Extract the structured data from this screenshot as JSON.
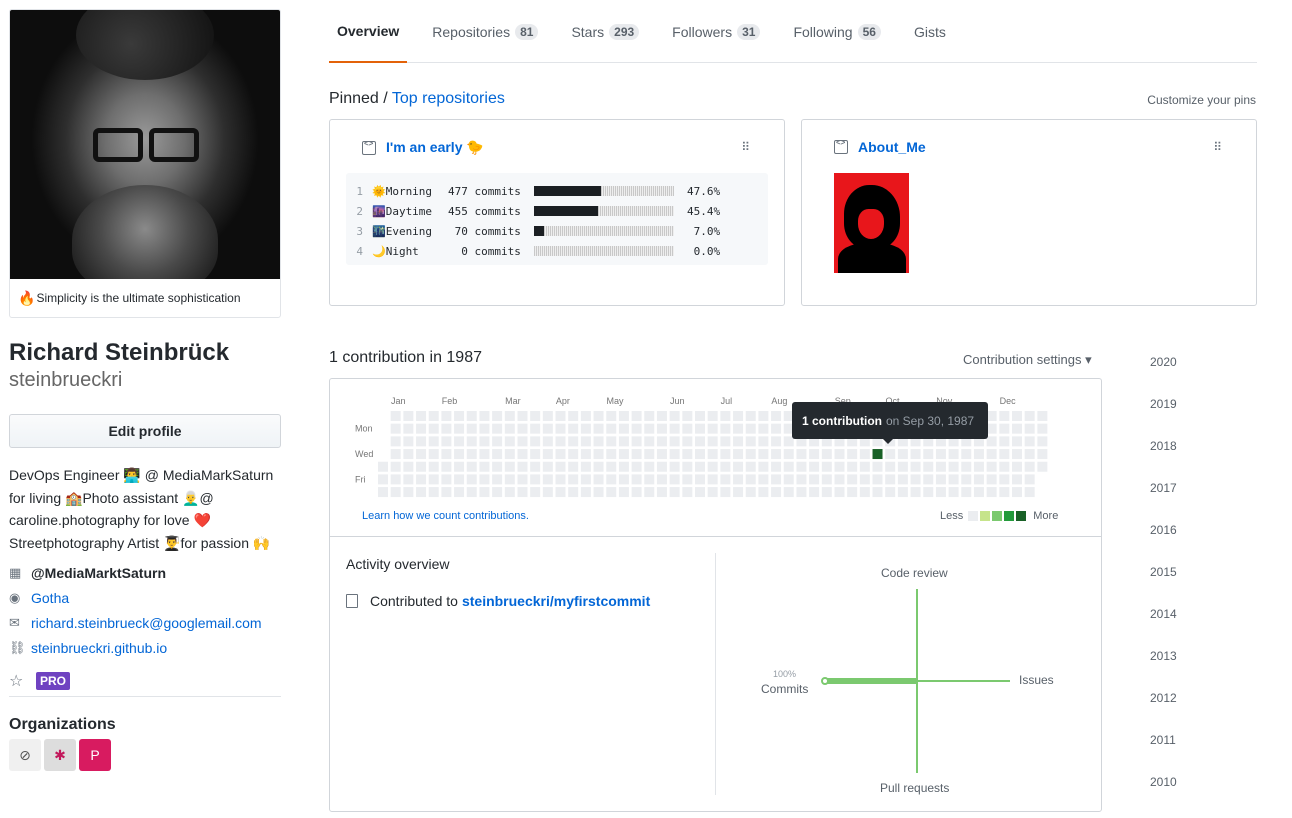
{
  "profile": {
    "status_emoji": "🔥",
    "status_text": "Simplicity is the ultimate sophistication",
    "fullname": "Richard Steinbrück",
    "username": "steinbrueckri",
    "edit_label": "Edit profile",
    "bio": "DevOps Engineer 👨‍💻 @ MediaMarkSaturn for living 🏫Photo assistant 👨‍🦳@ caroline.photography for love ❤️ Streetphotography Artist 👨‍🎓for passion 🙌",
    "company": "@MediaMarktSaturn",
    "location": "Gotha",
    "email": "richard.steinbrueck@googlemail.com",
    "website": "steinbrueckri.github.io",
    "pro_badge": "PRO",
    "orgs_heading": "Organizations",
    "icons": {
      "company": "building-icon",
      "location": "location-pin-icon",
      "email": "mail-icon",
      "website": "link-icon",
      "star": "star-icon"
    }
  },
  "nav": {
    "tabs": [
      {
        "label": "Overview",
        "count": ""
      },
      {
        "label": "Repositories",
        "count": "81"
      },
      {
        "label": "Stars",
        "count": "293"
      },
      {
        "label": "Followers",
        "count": "31"
      },
      {
        "label": "Following",
        "count": "56"
      },
      {
        "label": "Gists",
        "count": ""
      }
    ],
    "active_color": "#e36209"
  },
  "pinned": {
    "heading": "Pinned",
    "sep": "/",
    "heading_link": "Top repositories",
    "customize": "Customize your pins",
    "repos": [
      {
        "name": "I'm an early 🐤",
        "lines": [
          {
            "n": "1",
            "emoji": "🌞",
            "label": "Morning",
            "commits": "477 commits",
            "pct_text": "47.6%",
            "pct": 47.6
          },
          {
            "n": "2",
            "emoji": "🌆",
            "label": "Daytime",
            "commits": "455 commits",
            "pct_text": "45.4%",
            "pct": 45.4
          },
          {
            "n": "3",
            "emoji": "🌃",
            "label": "Evening",
            "commits": " 70 commits",
            "pct_text": " 7.0%",
            "pct": 7.0
          },
          {
            "n": "4",
            "emoji": "🌙",
            "label": "Night",
            "commits": "  0 commits",
            "pct_text": " 0.0%",
            "pct": 0.0
          }
        ]
      },
      {
        "name": "About_Me"
      }
    ]
  },
  "contributions": {
    "heading": "1 contribution in 1987",
    "settings": "Contribution settings ▾",
    "months": [
      "Jan",
      "Feb",
      "Mar",
      "Apr",
      "May",
      "Jun",
      "Jul",
      "Aug",
      "Sep",
      "Oct",
      "Nov",
      "Dec"
    ],
    "days": [
      "Mon",
      "Wed",
      "Fri"
    ],
    "learn": "Learn how we count contributions.",
    "less": "Less",
    "more": "More",
    "legend_colors": [
      "#ebedf0",
      "#c6e48b",
      "#7bc96f",
      "#239a3b",
      "#196127"
    ],
    "tooltip_count": "1 contribution",
    "tooltip_date": "on Sep 30, 1987",
    "active_week": 39,
    "active_day": 3
  },
  "activity": {
    "heading": "Activity overview",
    "contributed_to": "Contributed to",
    "repo_link": "steinbrueckri/myfirstcommit",
    "axes": {
      "top": "Code review",
      "left": "Commits",
      "right": "Issues",
      "bottom": "Pull requests"
    },
    "commits_pct": "100%",
    "axis_color": "#7bc96f"
  },
  "years": [
    "2020",
    "2019",
    "2018",
    "2017",
    "2016",
    "2015",
    "2014",
    "2013",
    "2012",
    "2011",
    "2010"
  ]
}
